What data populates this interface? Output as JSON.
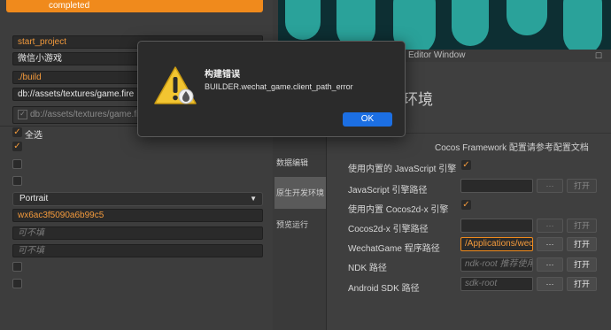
{
  "build_panel": {
    "progress_label": "completed",
    "project_name": "start_project",
    "platform": "微信小游戏",
    "build_path": "./build",
    "start_scene": "db://assets/textures/game.fire",
    "included_scene": "db://assets/textures/game.fire",
    "select_all_label": "全选",
    "orientation": "Portrait",
    "appid": "wx6ac3f5090a6b99c5",
    "optional_placeholder_1": "可不填",
    "optional_placeholder_2": "可不填"
  },
  "editor_window": {
    "title": "Editor Window"
  },
  "settings": {
    "tabs": [
      "数据编辑",
      "原生开发环境",
      "预览运行"
    ],
    "section_title": "环境",
    "doc_line": "Cocos Framework 配置请参考配置文档",
    "rows": [
      {
        "label": "使用内置的 JavaScript 引擎",
        "type": "checkbox",
        "checked": true
      },
      {
        "label": "JavaScript 引擎路径",
        "type": "path",
        "value": "",
        "dots": "···",
        "open": "打开"
      },
      {
        "label": "使用内置 Cocos2d-x 引擎",
        "type": "checkbox",
        "checked": true
      },
      {
        "label": "Cocos2d-x 引擎路径",
        "type": "path",
        "value": "",
        "dots": "···",
        "open": "打开"
      },
      {
        "label": "WechatGame 程序路径",
        "type": "path",
        "value": "/Applications/wec",
        "dots": "···",
        "open": "打开"
      },
      {
        "label": "NDK 路径",
        "type": "path",
        "placeholder": "ndk-root 推荐使用",
        "dots": "···",
        "open": "打开"
      },
      {
        "label": "Android SDK 路径",
        "type": "path",
        "placeholder": "sdk-root",
        "dots": "···",
        "open": "打开"
      }
    ]
  },
  "dialog": {
    "title": "构建错误",
    "message": "BUILDER.wechat_game.client_path_error",
    "ok_label": "OK"
  },
  "colors": {
    "accent": "#f08a1c",
    "ok_button": "#1c6fe3",
    "preview_bg": "#0d2f33",
    "preview_shape": "#2aa29a"
  }
}
